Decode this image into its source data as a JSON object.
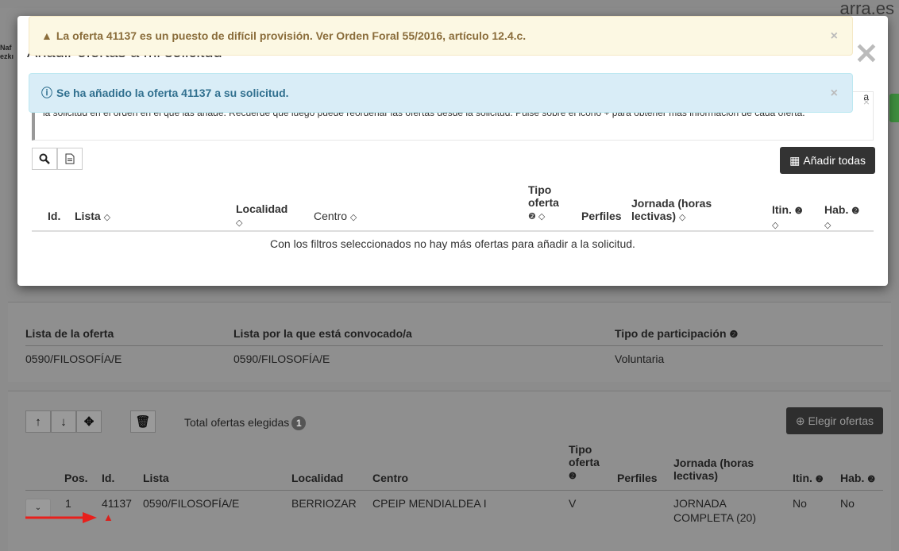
{
  "background": {
    "brand_text": "arra.es",
    "nav_text": "Naf\nezkı",
    "info_section": {
      "headers": [
        "Lista de la oferta",
        "Lista por la que está convocado/a",
        "Tipo de participación"
      ],
      "values": [
        "0590/FILOSOFÍA/E",
        "0590/FILOSOFÍA/E",
        "Voluntaria"
      ]
    },
    "chosen_section": {
      "total_label": "Total ofertas elegidas",
      "total_count": "1",
      "choose_button": "Elegir ofertas",
      "headers": {
        "pos": "Pos.",
        "id": "Id.",
        "lista": "Lista",
        "localidad": "Localidad",
        "centro": "Centro",
        "tipo_oferta": "Tipo oferta",
        "perfiles": "Perfiles",
        "jornada": "Jornada (horas lectivas)",
        "itin": "Itin.",
        "hab": "Hab."
      },
      "row": {
        "pos": "1",
        "id": "41137",
        "lista": "0590/FILOSOFÍA/E",
        "localidad": "BERRIOZAR",
        "centro": "CPEIP MENDIALDEA I",
        "tipo_oferta": "V",
        "jornada": "JORNADA COMPLETA (20)",
        "itin": "No",
        "hab": "No"
      }
    }
  },
  "alerts": {
    "warning": "La oferta 41137 es un puesto de difícil provisión. Ver Orden Foral 55/2016, artículo 12.4.c.",
    "info": "Se ha añadido la oferta 41137 a su solicitud."
  },
  "modal": {
    "title": "Añadir ofertas a mi solicitud",
    "intro_text": "la solicitud en el orden en el que las añade. Recuerde que luego puede reordenar las ofertas desde la solicitud. Pulse sobre el icono + para obtener más información de cada oferta.",
    "intro_trailing": "a",
    "add_all_button": "Añadir todas",
    "headers": {
      "id": "Id.",
      "lista": "Lista",
      "localidad": "Localidad",
      "centro": "Centro",
      "tipo_oferta": "Tipo oferta",
      "perfiles": "Perfiles",
      "jornada": "Jornada (horas lectivas)",
      "itin": "Itin.",
      "hab": "Hab."
    },
    "empty_message": "Con los filtros seleccionados no hay más ofertas para añadir a la solicitud."
  },
  "colors": {
    "warning_bg": "#fcf8e3",
    "warning_text": "#8a6d3b",
    "info_bg": "#d9edf7",
    "info_text": "#31708f",
    "annotation_arrow": "#e8201c"
  }
}
